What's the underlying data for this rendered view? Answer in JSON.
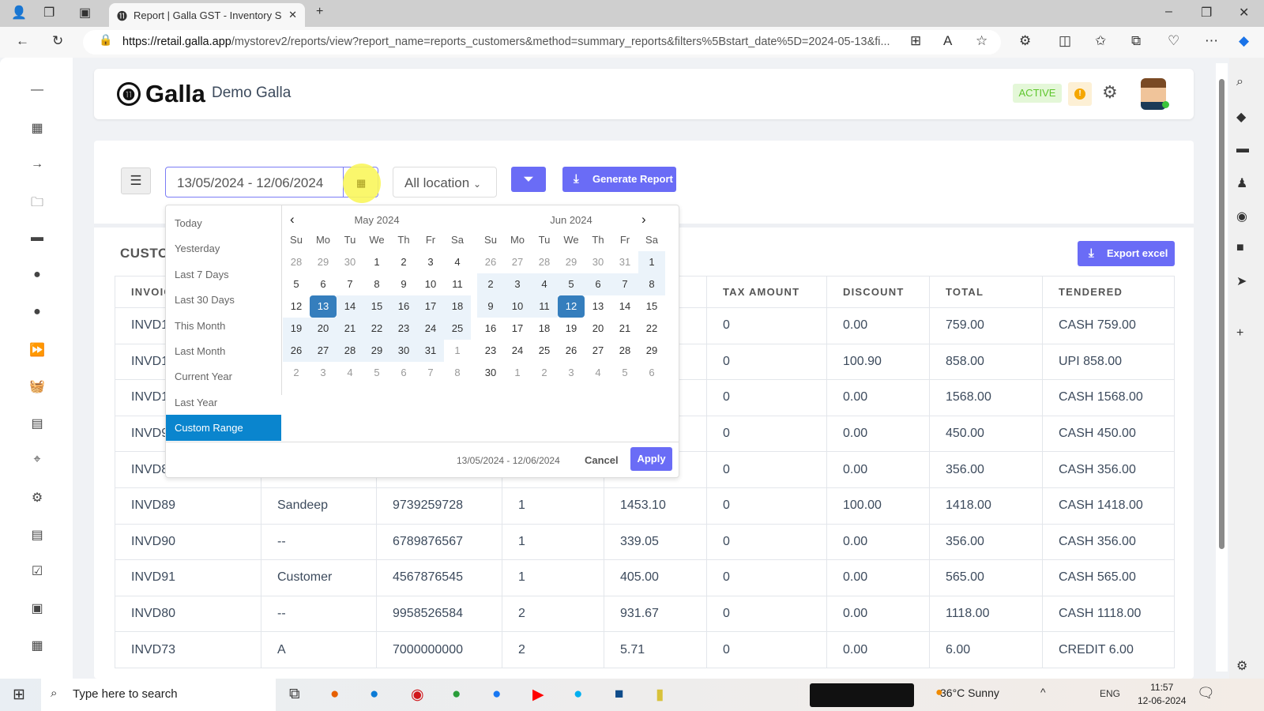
{
  "browser": {
    "tab_title": "Report | Galla GST - Inventory So",
    "url_host": "https://retail.galla.app",
    "url_path": "/mystorev2/reports/view?report_name=reports_customers&method=summary_reports&filters%5Bstart_date%5D=2024-05-13&fi..."
  },
  "header": {
    "brand": "Galla",
    "store_name": "Demo Galla",
    "status": "ACTIVE",
    "warning": "!"
  },
  "toolbar": {
    "date_range": "13/05/2024 - 12/06/2024",
    "location": "All location",
    "generate_label": "Generate Report",
    "export_label": "Export excel"
  },
  "report": {
    "title": "CUSTO",
    "columns": [
      "INVOIC",
      "",
      "",
      "",
      "",
      "TAX AMOUNT",
      "DISCOUNT",
      "TOTAL",
      "TENDERED"
    ],
    "rows": [
      [
        "INVD1",
        "",
        "",
        "",
        "",
        "0",
        "0.00",
        "759.00",
        "CASH 759.00"
      ],
      [
        "INVD1",
        "",
        "",
        "",
        "",
        "0",
        "100.90",
        "858.00",
        "UPI 858.00"
      ],
      [
        "INVD1",
        "",
        "",
        "",
        "",
        "0",
        "0.00",
        "1568.00",
        "CASH 1568.00"
      ],
      [
        "INVD9",
        "",
        "",
        "",
        "",
        "0",
        "0.00",
        "450.00",
        "CASH 450.00"
      ],
      [
        "INVD8",
        "",
        "",
        "",
        "",
        "0",
        "0.00",
        "356.00",
        "CASH 356.00"
      ],
      [
        "INVD89",
        "Sandeep",
        "9739259728",
        "1",
        "1453.10",
        "0",
        "100.00",
        "1418.00",
        "CASH 1418.00"
      ],
      [
        "INVD90",
        "--",
        "6789876567",
        "1",
        "339.05",
        "0",
        "0.00",
        "356.00",
        "CASH 356.00"
      ],
      [
        "INVD91",
        "Customer",
        "4567876545",
        "1",
        "405.00",
        "0",
        "0.00",
        "565.00",
        "CASH 565.00"
      ],
      [
        "INVD80",
        "--",
        "9958526584",
        "2",
        "931.67",
        "0",
        "0.00",
        "1118.00",
        "CASH 1118.00"
      ],
      [
        "INVD73",
        "A",
        "7000000000",
        "2",
        "5.71",
        "0",
        "0.00",
        "6.00",
        "CREDIT 6.00"
      ]
    ]
  },
  "datepicker": {
    "ranges": [
      "Today",
      "Yesterday",
      "Last 7 Days",
      "Last 30 Days",
      "This Month",
      "Last Month",
      "Current Year",
      "Last Year",
      "Custom Range"
    ],
    "active_range": "Custom Range",
    "weekdays": [
      "Su",
      "Mo",
      "Tu",
      "We",
      "Th",
      "Fr",
      "Sa"
    ],
    "months": [
      {
        "label": "May 2024",
        "weeks": [
          [
            28,
            29,
            30,
            1,
            2,
            3,
            4
          ],
          [
            5,
            6,
            7,
            8,
            9,
            10,
            11
          ],
          [
            12,
            13,
            14,
            15,
            16,
            17,
            18
          ],
          [
            19,
            20,
            21,
            22,
            23,
            24,
            25
          ],
          [
            26,
            27,
            28,
            29,
            30,
            31,
            1
          ],
          [
            2,
            3,
            4,
            5,
            6,
            7,
            8
          ]
        ],
        "range_from": 13,
        "range_to": 31,
        "selected": 13
      },
      {
        "label": "Jun 2024",
        "weeks": [
          [
            26,
            27,
            28,
            29,
            30,
            31,
            1
          ],
          [
            2,
            3,
            4,
            5,
            6,
            7,
            8
          ],
          [
            9,
            10,
            11,
            12,
            13,
            14,
            15
          ],
          [
            16,
            17,
            18,
            19,
            20,
            21,
            22
          ],
          [
            23,
            24,
            25,
            26,
            27,
            28,
            29
          ],
          [
            30,
            1,
            2,
            3,
            4,
            5,
            6
          ]
        ],
        "range_from": 1,
        "range_to": 12,
        "selected": 12
      }
    ],
    "footer_range": "13/05/2024 - 12/06/2024",
    "cancel": "Cancel",
    "apply": "Apply"
  },
  "taskbar": {
    "search_placeholder": "Type here to search",
    "weather": "36°C  Sunny",
    "lang": "ENG",
    "time": "11:57",
    "date": "12-06-2024"
  },
  "colors": {
    "accent": "#6a6cf6",
    "range_active": "#0a85ce",
    "selected_day": "#357ebd",
    "active_badge": "#5fc62e"
  }
}
